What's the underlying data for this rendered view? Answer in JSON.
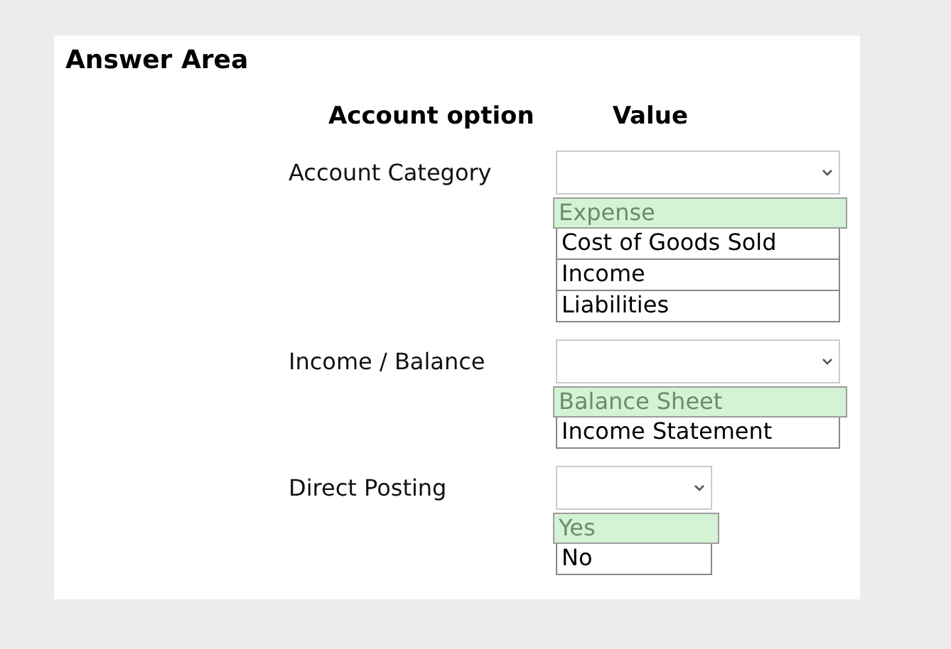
{
  "title": "Answer Area",
  "columns": [
    "Account option",
    "Value"
  ],
  "rows": [
    {
      "label": "Account Category",
      "wide": true,
      "options": [
        {
          "text": "Expense",
          "selected": true
        },
        {
          "text": "Cost of Goods Sold",
          "selected": false
        },
        {
          "text": "Income",
          "selected": false
        },
        {
          "text": "Liabilities",
          "selected": false
        }
      ]
    },
    {
      "label": "Income / Balance",
      "wide": true,
      "options": [
        {
          "text": "Balance Sheet",
          "selected": true
        },
        {
          "text": "Income Statement",
          "selected": false
        }
      ]
    },
    {
      "label": "Direct Posting",
      "wide": false,
      "options": [
        {
          "text": "Yes",
          "selected": true
        },
        {
          "text": "No",
          "selected": false
        }
      ]
    }
  ]
}
